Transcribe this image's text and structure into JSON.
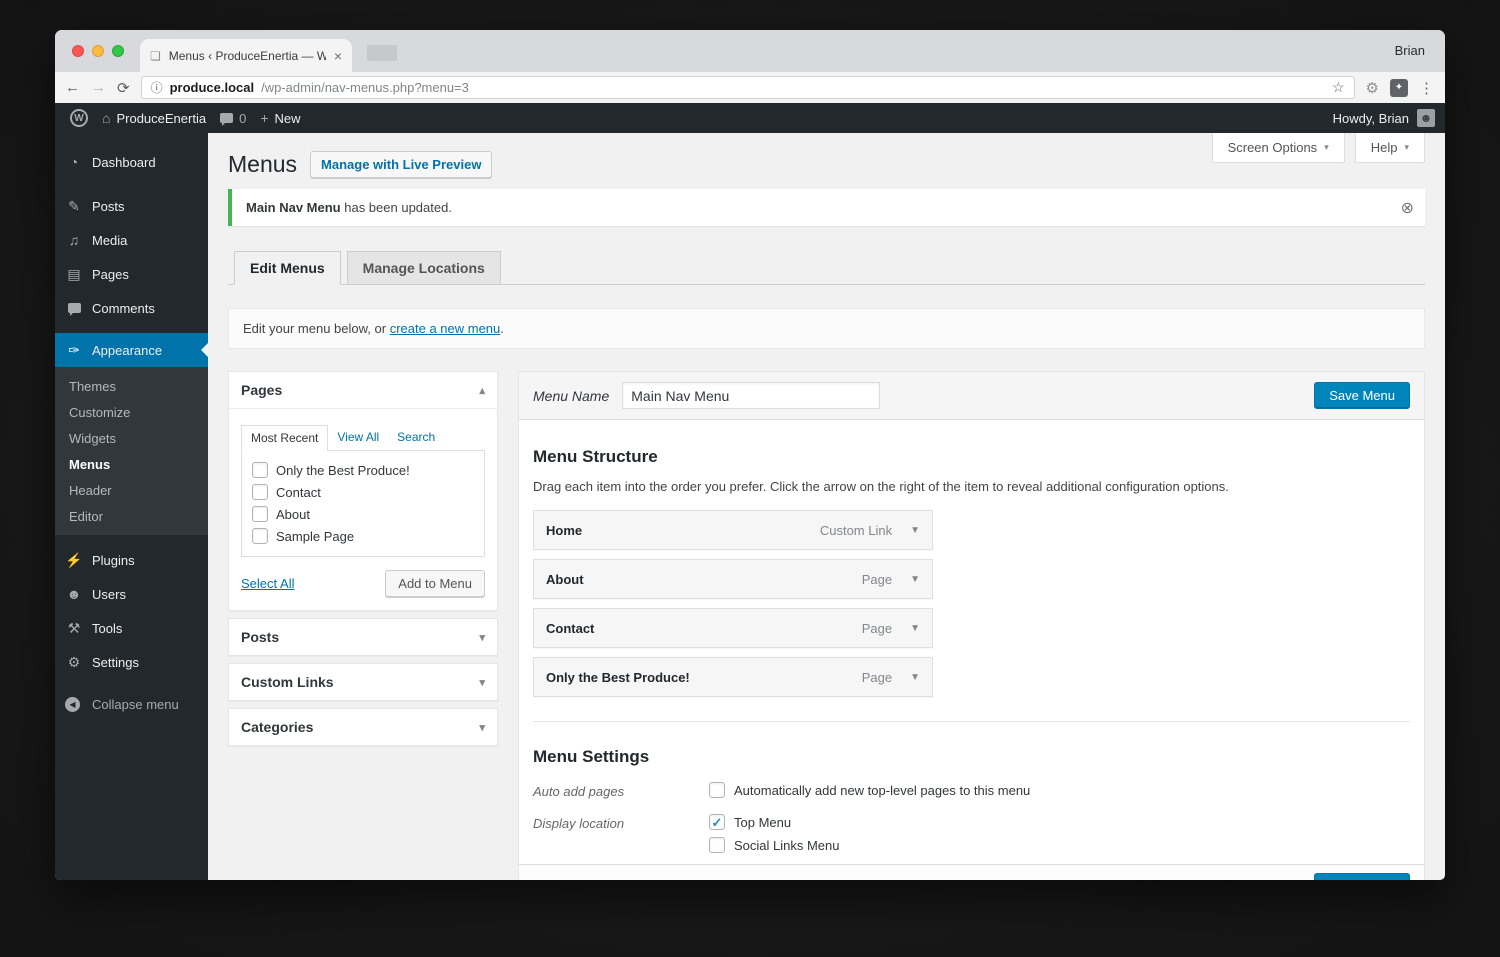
{
  "colors": {
    "accent": "#0073aa",
    "primary_button": "#0085ba",
    "notice_green": "#46b450",
    "admin_dark": "#23282d"
  },
  "browser": {
    "tab_title": "Menus ‹ ProduceEnertia — Wo",
    "tab_close": "×",
    "profile_name": "Brian",
    "url_host": "produce.local",
    "url_path": "/wp-admin/nav-menus.php?menu=3"
  },
  "icons": {
    "back": "←",
    "forward": "→",
    "refresh": "⟳",
    "info": "ⓘ",
    "star": "☆",
    "menu_dots": "⋮",
    "ext_gear": "⚙",
    "ext_bulb": "✦",
    "favicon": "❏",
    "wp": "W",
    "home": "⌂",
    "plus": "+",
    "dashboard": "◔",
    "posts": "✎",
    "media": "♫",
    "pages": "▤",
    "appearance": "✑",
    "plugins": "⚡",
    "users": "☻",
    "tools": "⚒",
    "settings": "⚙",
    "collapse": "◀",
    "avatar": "☻",
    "dropdown": "▾",
    "panel_up": "▴",
    "panel_down": "▾",
    "item_down": "▼",
    "dismiss": "⊗",
    "check": "✓"
  },
  "admin_bar": {
    "site_name": "ProduceEnertia",
    "comment_count": "0",
    "new_label": "New",
    "howdy": "Howdy, Brian"
  },
  "sidebar": {
    "items": [
      {
        "label": "Dashboard"
      },
      {
        "label": "Posts"
      },
      {
        "label": "Media"
      },
      {
        "label": "Pages"
      },
      {
        "label": "Comments"
      },
      {
        "label": "Appearance"
      },
      {
        "label": "Plugins"
      },
      {
        "label": "Users"
      },
      {
        "label": "Tools"
      },
      {
        "label": "Settings"
      },
      {
        "label": "Collapse menu"
      }
    ],
    "appearance_submenu": [
      {
        "label": "Themes"
      },
      {
        "label": "Customize"
      },
      {
        "label": "Widgets"
      },
      {
        "label": "Menus"
      },
      {
        "label": "Header"
      },
      {
        "label": "Editor"
      }
    ]
  },
  "page": {
    "title": "Menus",
    "live_preview_label": "Manage with Live Preview",
    "screen_options_label": "Screen Options",
    "help_label": "Help",
    "notice_bold": "Main Nav Menu",
    "notice_text": " has been updated.",
    "tab_edit": "Edit Menus",
    "tab_locations": "Manage Locations",
    "edit_bar_prefix": "Edit your menu below, or ",
    "edit_bar_link": "create a new menu",
    "edit_bar_suffix": "."
  },
  "pages_panel": {
    "title": "Pages",
    "tabs": {
      "most_recent": "Most Recent",
      "view_all": "View All",
      "search": "Search"
    },
    "items": [
      {
        "label": "Only the Best Produce!"
      },
      {
        "label": "Contact"
      },
      {
        "label": "About"
      },
      {
        "label": "Sample Page"
      }
    ],
    "select_all_label": "Select All",
    "add_to_menu_label": "Add to Menu"
  },
  "accordions": [
    {
      "title": "Posts"
    },
    {
      "title": "Custom Links"
    },
    {
      "title": "Categories"
    }
  ],
  "editor": {
    "menu_name_label": "Menu Name",
    "menu_name_value": "Main Nav Menu",
    "save_label": "Save Menu",
    "structure_title": "Menu Structure",
    "structure_desc": "Drag each item into the order you prefer. Click the arrow on the right of the item to reveal additional configuration options.",
    "items": [
      {
        "label": "Home",
        "type": "Custom Link"
      },
      {
        "label": "About",
        "type": "Page"
      },
      {
        "label": "Contact",
        "type": "Page"
      },
      {
        "label": "Only the Best Produce!",
        "type": "Page"
      }
    ],
    "settings_title": "Menu Settings",
    "auto_add_label": "Auto add pages",
    "auto_add_option": "Automatically add new top-level pages to this menu",
    "display_label": "Display location",
    "locations": [
      {
        "label": "Top Menu",
        "checked": true
      },
      {
        "label": "Social Links Menu",
        "checked": false
      }
    ]
  }
}
